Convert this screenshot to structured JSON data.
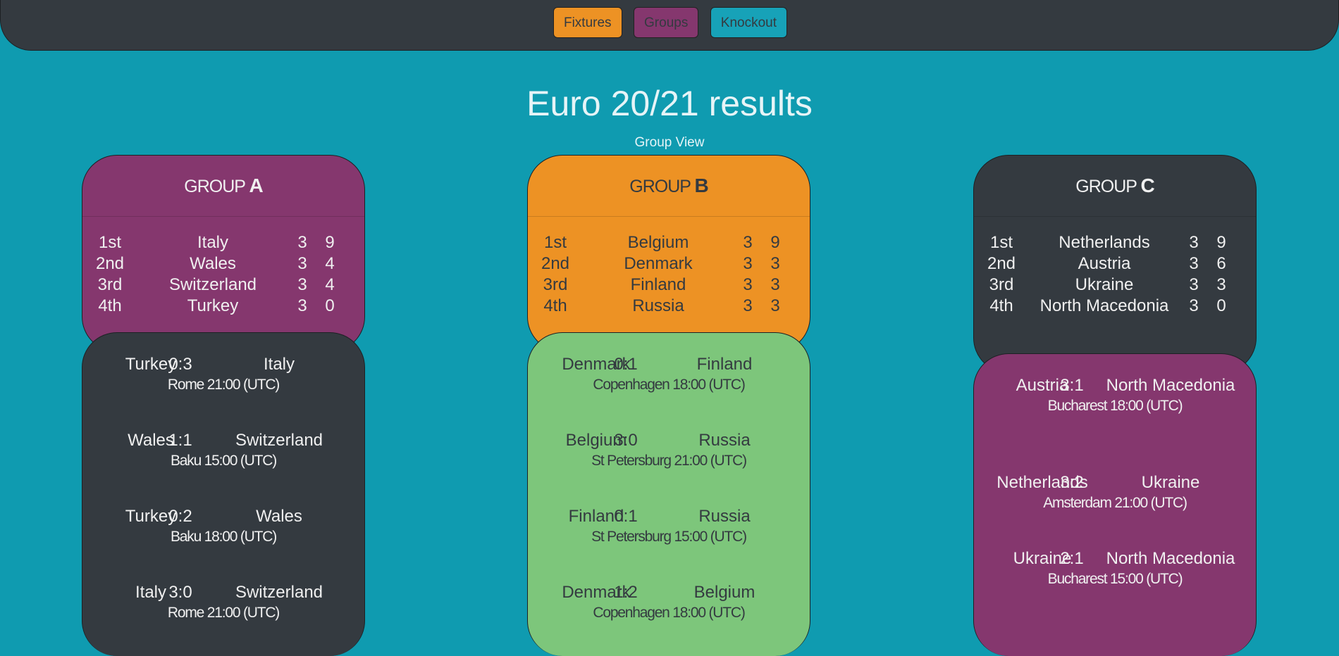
{
  "nav": {
    "fixtures": "Fixtures",
    "groups": "Groups",
    "knockout": "Knockout"
  },
  "page": {
    "title": "Euro 20/21 results",
    "subtitle": "Group View"
  },
  "colors": {
    "background": "#0f9bb0",
    "dark": "#343a40",
    "purple": "#85376e",
    "orange": "#ed9224",
    "green": "#7dc67b",
    "teal_button": "#17a2b8"
  },
  "groups": [
    {
      "prefix": "GROUP",
      "letter": "A",
      "standings": [
        {
          "pos": "1st",
          "team": "Italy",
          "played": "3",
          "points": "9"
        },
        {
          "pos": "2nd",
          "team": "Wales",
          "played": "3",
          "points": "4"
        },
        {
          "pos": "3rd",
          "team": "Switzerland",
          "played": "3",
          "points": "4"
        },
        {
          "pos": "4th",
          "team": "Turkey",
          "played": "3",
          "points": "0"
        }
      ],
      "matches": [
        {
          "home": "Turkey",
          "score": "0:3",
          "away": "Italy",
          "venue": "Rome 21:00 (UTC)"
        },
        {
          "home": "Wales",
          "score": "1:1",
          "away": "Switzerland",
          "venue": "Baku 15:00 (UTC)"
        },
        {
          "home": "Turkey",
          "score": "0:2",
          "away": "Wales",
          "venue": "Baku 18:00 (UTC)"
        },
        {
          "home": "Italy",
          "score": "3:0",
          "away": "Switzerland",
          "venue": "Rome 21:00 (UTC)"
        }
      ]
    },
    {
      "prefix": "GROUP",
      "letter": "B",
      "standings": [
        {
          "pos": "1st",
          "team": "Belgium",
          "played": "3",
          "points": "9"
        },
        {
          "pos": "2nd",
          "team": "Denmark",
          "played": "3",
          "points": "3"
        },
        {
          "pos": "3rd",
          "team": "Finland",
          "played": "3",
          "points": "3"
        },
        {
          "pos": "4th",
          "team": "Russia",
          "played": "3",
          "points": "3"
        }
      ],
      "matches": [
        {
          "home": "Denmark",
          "score": "0:1",
          "away": "Finland",
          "venue": "Copenhagen 18:00 (UTC)"
        },
        {
          "home": "Belgium",
          "score": "3:0",
          "away": "Russia",
          "venue": "St Petersburg 21:00 (UTC)"
        },
        {
          "home": "Finland",
          "score": "0:1",
          "away": "Russia",
          "venue": "St Petersburg 15:00 (UTC)"
        },
        {
          "home": "Denmark",
          "score": "1:2",
          "away": "Belgium",
          "venue": "Copenhagen 18:00 (UTC)"
        }
      ]
    },
    {
      "prefix": "GROUP",
      "letter": "C",
      "standings": [
        {
          "pos": "1st",
          "team": "Netherlands",
          "played": "3",
          "points": "9"
        },
        {
          "pos": "2nd",
          "team": "Austria",
          "played": "3",
          "points": "6"
        },
        {
          "pos": "3rd",
          "team": "Ukraine",
          "played": "3",
          "points": "3"
        },
        {
          "pos": "4th",
          "team": "North Macedonia",
          "played": "3",
          "points": "0"
        }
      ],
      "matches": [
        {
          "home": "Austria",
          "score": "3:1",
          "away": "North Macedonia",
          "venue": "Bucharest 18:00 (UTC)"
        },
        {
          "home": "Netherlands",
          "score": "3:2",
          "away": "Ukraine",
          "venue": "Amsterdam 21:00 (UTC)"
        },
        {
          "home": "Ukraine",
          "score": "2:1",
          "away": "North Macedonia",
          "venue": "Bucharest 15:00 (UTC)"
        }
      ]
    }
  ]
}
